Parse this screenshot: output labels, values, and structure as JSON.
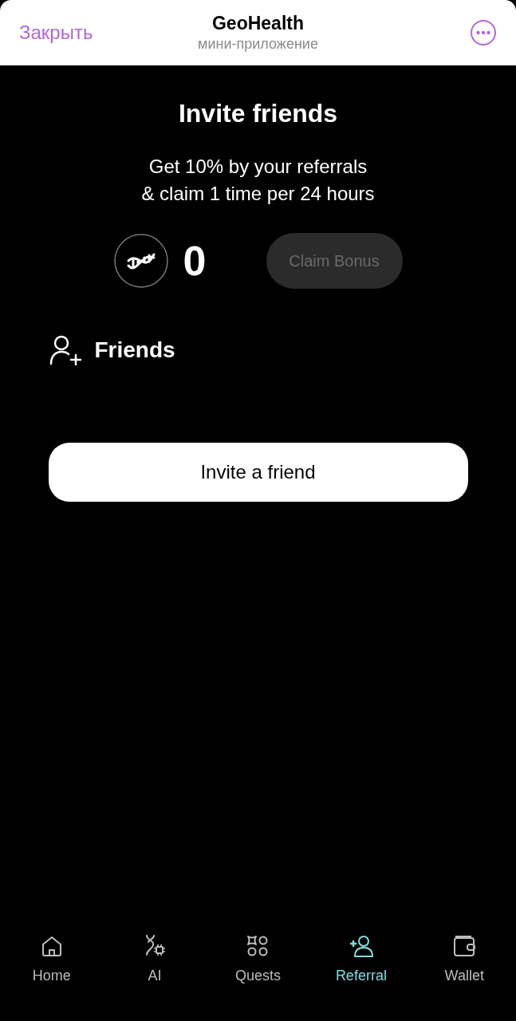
{
  "header": {
    "close": "Закрыть",
    "title": "GeoHealth",
    "subtitle": "мини-приложение"
  },
  "title": "Invite friends",
  "description": [
    "Get 10% by your referrals",
    "& claim 1 time per 24 hours"
  ],
  "balance": "0",
  "claim_button": {
    "label": "Claim Bonus",
    "disabled": true
  },
  "friends_label": "Friends",
  "invite_button": "Invite a friend",
  "nav": [
    {
      "kind": "home",
      "label": "Home",
      "selected": false
    },
    {
      "kind": "ai",
      "label": "AI",
      "selected": false
    },
    {
      "kind": "quests",
      "label": "Quests",
      "selected": false
    },
    {
      "kind": "referral",
      "label": "Referral",
      "selected": true
    },
    {
      "kind": "wallet",
      "label": "Wallet",
      "selected": false
    }
  ]
}
